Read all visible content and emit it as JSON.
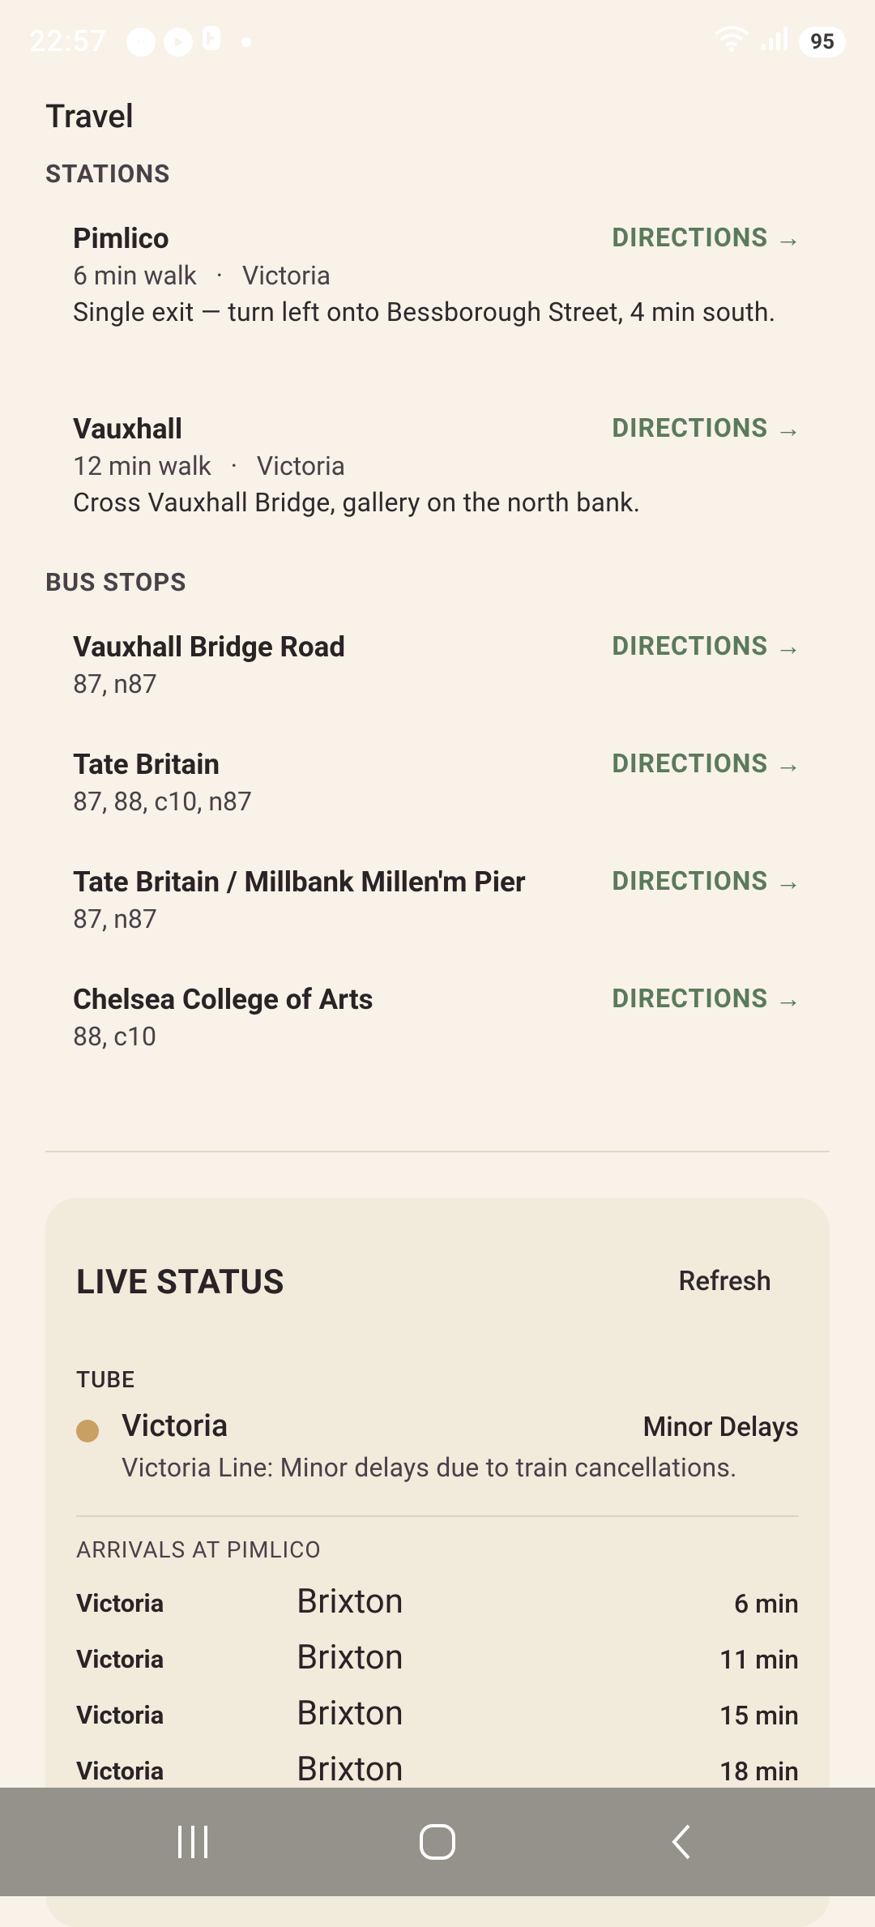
{
  "status": {
    "time": "22:57",
    "battery": "95",
    "notif_icons": [
      "messenger-icon",
      "play-icon",
      "bixby-icon"
    ]
  },
  "page": {
    "title": "Travel"
  },
  "stations": {
    "label": "STATIONS",
    "items": [
      {
        "name": "Pimlico",
        "walk": "6 min walk",
        "line": "Victoria",
        "desc": "Single exit — turn left onto Bessborough Street, 4 min south.",
        "action": "DIRECTIONS →"
      },
      {
        "name": "Vauxhall",
        "walk": "12 min walk",
        "line": "Victoria",
        "desc": "Cross Vauxhall Bridge, gallery on the north bank.",
        "action": "DIRECTIONS →"
      }
    ]
  },
  "bus_stops": {
    "label": "BUS STOPS",
    "items": [
      {
        "name": "Vauxhall Bridge Road",
        "routes": "87, n87",
        "action": "DIRECTIONS →"
      },
      {
        "name": "Tate Britain",
        "routes": "87, 88, c10, n87",
        "action": "DIRECTIONS →"
      },
      {
        "name": "Tate Britain / Millbank Millen'm Pier",
        "routes": "87, n87",
        "action": "DIRECTIONS →"
      },
      {
        "name": "Chelsea College of Arts",
        "routes": "88, c10",
        "action": "DIRECTIONS →"
      }
    ]
  },
  "live": {
    "title": "LIVE STATUS",
    "refresh": "Refresh",
    "tube_label": "TUBE",
    "line": {
      "name": "Victoria",
      "status": "Minor Delays",
      "message": "Victoria Line: Minor delays due to train cancellations.",
      "color": "#c9a063"
    },
    "arrivals_label": "ARRIVALS AT PIMLICO",
    "arrivals": [
      {
        "line": "Victoria",
        "dest": "Brixton",
        "time": "6 min"
      },
      {
        "line": "Victoria",
        "dest": "Brixton",
        "time": "11 min"
      },
      {
        "line": "Victoria",
        "dest": "Brixton",
        "time": "15 min"
      },
      {
        "line": "Victoria",
        "dest": "Brixton",
        "time": "18 min"
      }
    ]
  },
  "colors": {
    "background": "#f8f2e8",
    "accent": "#5a7a5b",
    "card": "#f2eadb",
    "nav": "#94928b"
  }
}
